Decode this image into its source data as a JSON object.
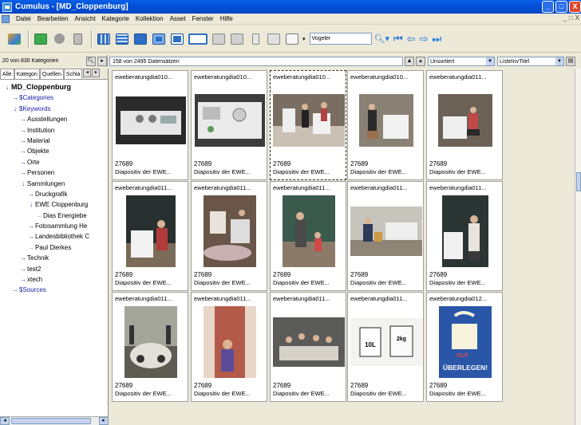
{
  "window": {
    "title": "Cumulus - [MD_Cloppenburg]",
    "minimize": "_",
    "maximize": "□",
    "close": "X"
  },
  "menu": {
    "items": [
      "Datei",
      "Bearbeiten",
      "Ansicht",
      "Kategorie",
      "Kollektion",
      "Asset",
      "Fenster",
      "Hilfe"
    ],
    "mdi_controls": [
      "_",
      "□",
      "X"
    ]
  },
  "toolbar": {
    "search_value": "Vogeler"
  },
  "left_status": {
    "count_text": "20 von 830 Kategorien"
  },
  "right_status": {
    "count_text": "158 von 2495 Datensätzen",
    "sort_value": "Unsortiert",
    "view_value": "ListeInvTitel"
  },
  "tabs": [
    "Alle",
    "Kategori",
    "Quellen",
    "Schla"
  ],
  "tree": [
    {
      "label": "MD_Cloppenburg",
      "level": 0,
      "root": true
    },
    {
      "label": "$Categories",
      "level": 1,
      "special": true
    },
    {
      "label": "$Keywords",
      "level": 1,
      "special": true
    },
    {
      "label": "Ausstellungen",
      "level": 2
    },
    {
      "label": "Institution",
      "level": 2
    },
    {
      "label": "Material",
      "level": 2
    },
    {
      "label": "Objekte",
      "level": 2
    },
    {
      "label": "Orte",
      "level": 2
    },
    {
      "label": "Personen",
      "level": 2
    },
    {
      "label": "Sammlungen",
      "level": 2
    },
    {
      "label": "Druckgrafik",
      "level": 3
    },
    {
      "label": "EWE Cloppenburg",
      "level": 3
    },
    {
      "label": "Dias Energiebe",
      "level": 4,
      "faded": true
    },
    {
      "label": "Fotosammlung He",
      "level": 3
    },
    {
      "label": "Landesbibliothek C",
      "level": 3
    },
    {
      "label": "Paul Dierkes",
      "level": 3,
      "faded": true
    },
    {
      "label": "Technik",
      "level": 2
    },
    {
      "label": "test2",
      "level": 2
    },
    {
      "label": "xtech",
      "level": 2
    },
    {
      "label": "$Sources",
      "level": 1,
      "special": true
    }
  ],
  "records": [
    {
      "name": "eweberatungdia010...",
      "num": "27689",
      "desc": "Diapositiv der EWE...",
      "scene": "washer-dark"
    },
    {
      "name": "eweberatungdia010...",
      "num": "27689",
      "desc": "Diapositiv der EWE...",
      "scene": "washer-top"
    },
    {
      "name": "eweberatungdia010...",
      "num": "27689",
      "desc": "Diapositiv der EWE...",
      "scene": "women-kitchen",
      "selected": true
    },
    {
      "name": "eweberatungdia010...",
      "num": "27689",
      "desc": "Diapositiv der EWE...",
      "scene": "woman-dryer"
    },
    {
      "name": "eweberatungdia011...",
      "num": "27689",
      "desc": "Diapositiv der EWE...",
      "scene": "woman-kneel"
    },
    {
      "name": "eweberatungdia011...",
      "num": "27689",
      "desc": "Diapositiv der EWE...",
      "scene": "woman-machine"
    },
    {
      "name": "eweberatungdia011...",
      "num": "27689",
      "desc": "Diapositiv der EWE...",
      "scene": "laundry-pile"
    },
    {
      "name": "eweberatungdia011...",
      "num": "27689",
      "desc": "Diapositiv der EWE...",
      "scene": "woman-child"
    },
    {
      "name": "eweberatungdia011...",
      "num": "27689",
      "desc": "Diapositiv der EWE...",
      "scene": "room-wide"
    },
    {
      "name": "eweberatungdia011...",
      "num": "27689",
      "desc": "Diapositiv der EWE...",
      "scene": "woman-apron"
    },
    {
      "name": "eweberatungdia011...",
      "num": "27689",
      "desc": "Diapositiv der EWE...",
      "scene": "car-people"
    },
    {
      "name": "eweberatungdia011...",
      "num": "27689",
      "desc": "Diapositiv der EWE...",
      "scene": "curtains"
    },
    {
      "name": "eweberatungdia011...",
      "num": "27689",
      "desc": "Diapositiv der EWE...",
      "scene": "group-table"
    },
    {
      "name": "eweberatungdia011...",
      "num": "27689",
      "desc": "Diapositiv der EWE...",
      "scene": "boxes",
      "box_labels": [
        "10L",
        "2kg"
      ]
    },
    {
      "name": "eweberatungdia012...",
      "num": "27689",
      "desc": "Diapositiv der EWE...",
      "scene": "poster",
      "poster_text": [
        "GUT",
        "ÜBERLEGEN!"
      ]
    }
  ]
}
